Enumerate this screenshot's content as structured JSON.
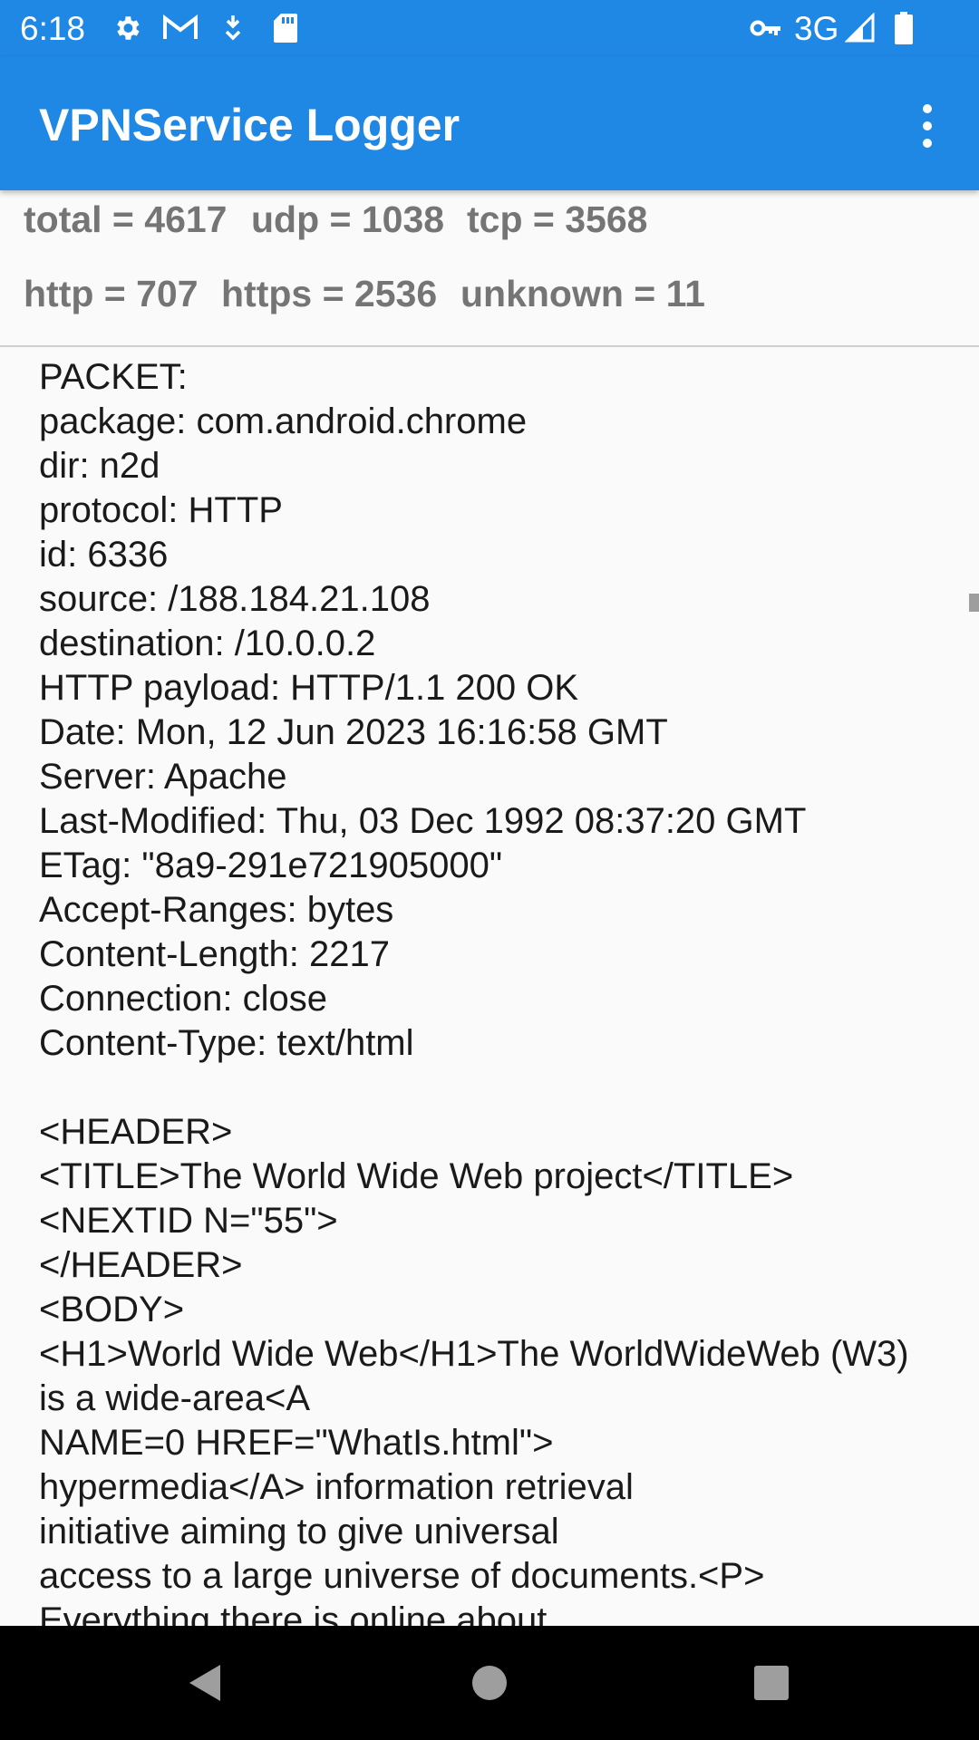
{
  "status_bar": {
    "time": "6:18",
    "icons": [
      "gear-icon",
      "gmail-icon",
      "download-icon",
      "sd-card-icon"
    ],
    "right_icons": [
      "vpn-key-icon",
      "signal-icon",
      "battery-icon"
    ],
    "network": "3G"
  },
  "app_bar": {
    "title": "VPNService Logger",
    "menu_icon": "more-vert-icon"
  },
  "stats": {
    "total": "total = 4617",
    "udp": "udp = 1038",
    "tcp": "tcp = 3568",
    "http": "http = 707",
    "https": "https = 2536",
    "unknown": "unknown = 11"
  },
  "log": {
    "text": "PACKET:\npackage: com.android.chrome\ndir: n2d\nprotocol: HTTP\nid: 6336\nsource: /188.184.21.108\ndestination: /10.0.0.2\nHTTP payload: HTTP/1.1 200 OK\nDate: Mon, 12 Jun 2023 16:16:58 GMT\nServer: Apache\nLast-Modified: Thu, 03 Dec 1992 08:37:20 GMT\nETag: \"8a9-291e721905000\"\nAccept-Ranges: bytes\nContent-Length: 2217\nConnection: close\nContent-Type: text/html\n\n<HEADER>\n<TITLE>The World Wide Web project</TITLE>\n<NEXTID N=\"55\">\n</HEADER>\n<BODY>\n<H1>World Wide Web</H1>The WorldWideWeb (W3)\nis a wide-area<A\nNAME=0 HREF=\"WhatIs.html\">\nhypermedia</A> information retrieval\ninitiative aiming to give universal\naccess to a large universe of documents.<P>\nEverything there is online about"
  },
  "nav_bar": {
    "buttons": [
      "back-icon",
      "home-icon",
      "recents-icon"
    ]
  },
  "colors": {
    "primary": "#1f88e5",
    "stat_text": "#757575",
    "background": "#fafafa"
  }
}
